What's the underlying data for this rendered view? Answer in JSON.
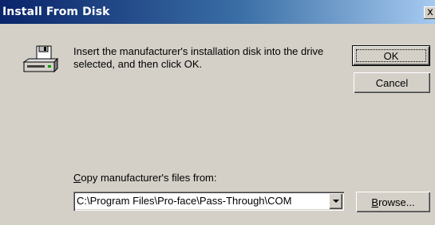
{
  "window": {
    "title": "Install From Disk",
    "close_glyph": "x"
  },
  "message": "Insert the manufacturer's installation disk into the drive selected, and then click OK.",
  "buttons": {
    "ok": "OK",
    "cancel": "Cancel",
    "browse_prefix": "B",
    "browse_rest": "rowse..."
  },
  "copy_from": {
    "label_prefix": "C",
    "label_rest": "opy manufacturer's files from:",
    "value": "C:\\Program Files\\Pro-face\\Pass-Through\\COM"
  },
  "icons": {
    "disk": "disk-drive-icon"
  }
}
